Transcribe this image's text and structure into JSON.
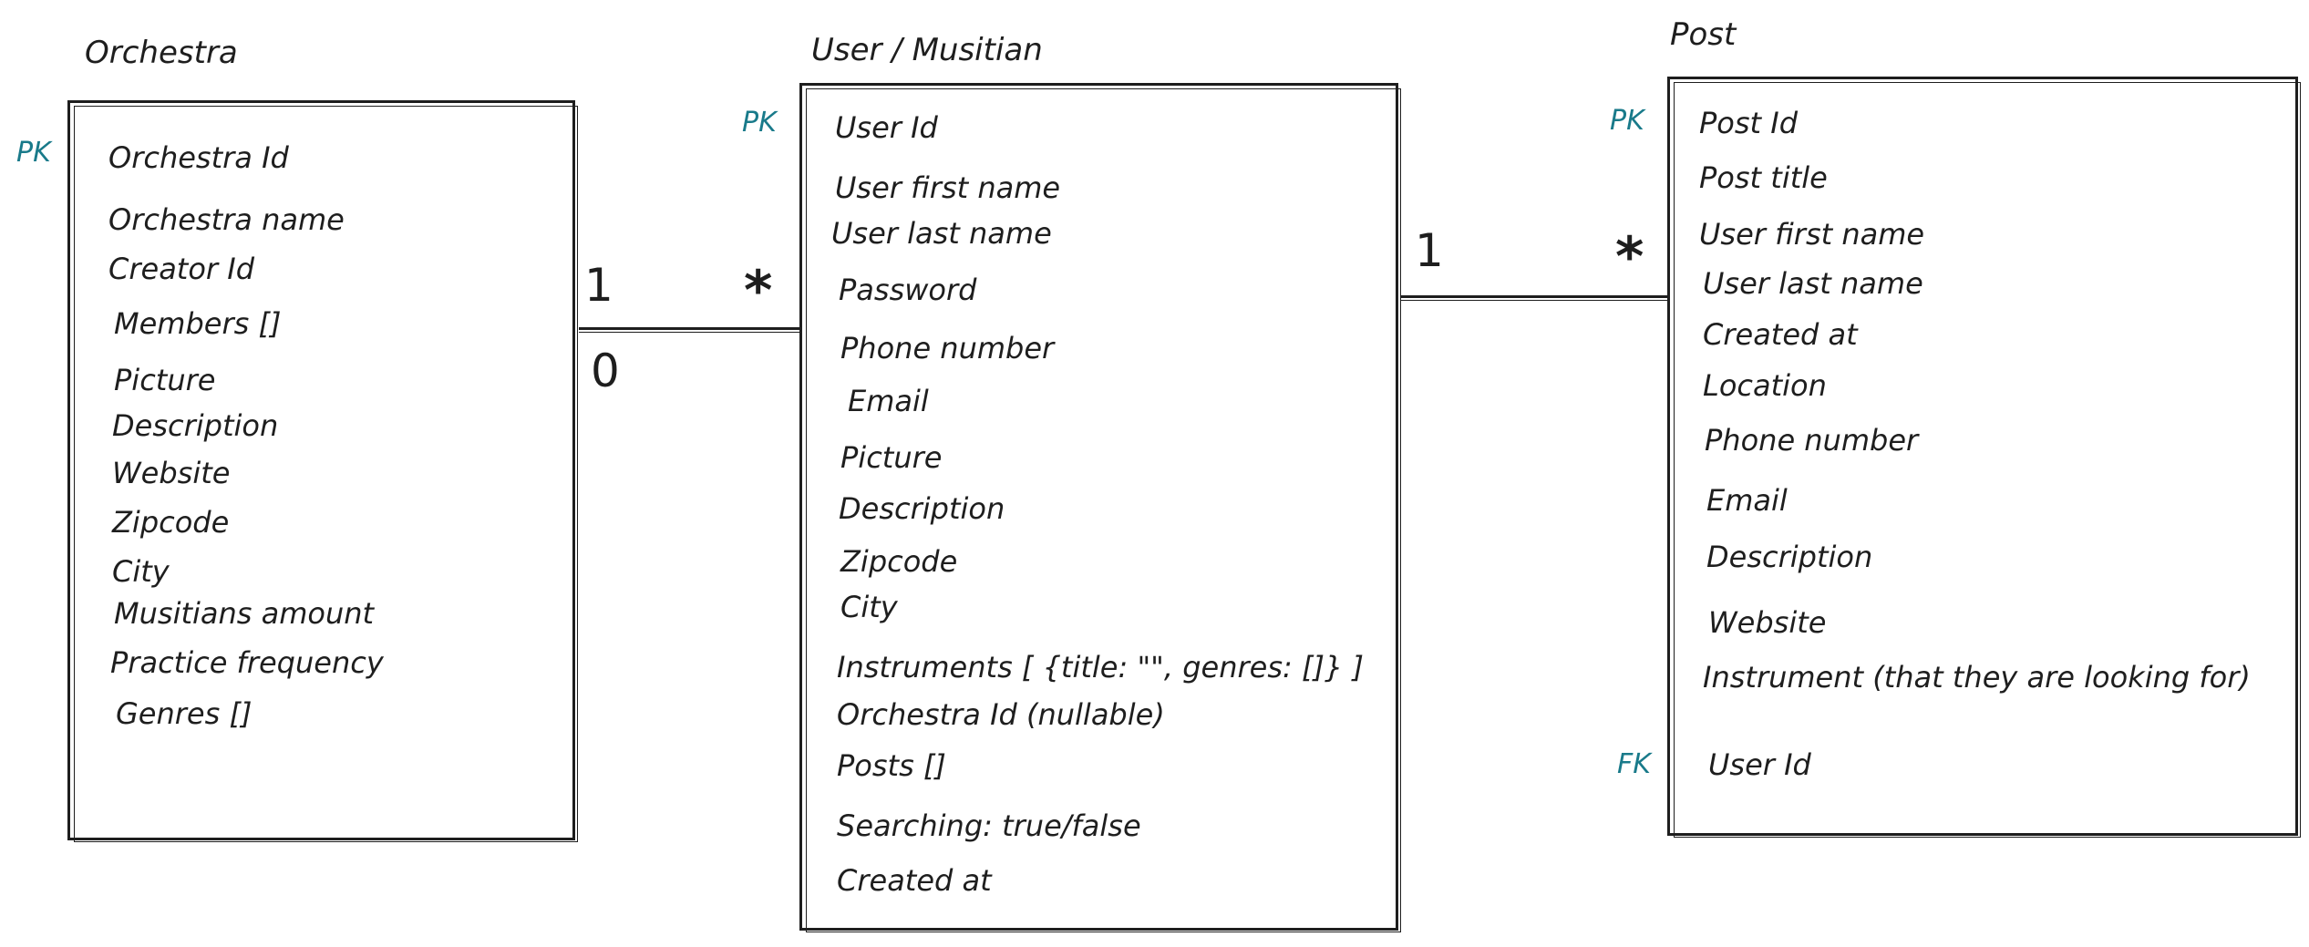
{
  "orchestra": {
    "title": "Orchestra",
    "pk_label": "PK",
    "fields": [
      "Orchestra Id",
      "Orchestra name",
      "Creator Id",
      "Members []",
      "Picture",
      "Description",
      "Website",
      "Zipcode",
      "City",
      "Musitians amount",
      "Practice frequency",
      "Genres []"
    ]
  },
  "user": {
    "title": "User / Musitian",
    "pk_label": "PK",
    "fields": [
      "User Id",
      "User first name",
      "User last name",
      "Password",
      "Phone number",
      "Email",
      "Picture",
      "Description",
      "Zipcode",
      "City",
      "Instruments [ {title: \"\", genres: []} ]",
      "Orchestra Id (nullable)",
      "Posts []",
      "Searching: true/false",
      "Created at"
    ]
  },
  "post": {
    "title": "Post",
    "pk_label": "PK",
    "fk_label": "FK",
    "fields": [
      "Post Id",
      "Post title",
      "User first name",
      "User last name",
      "Created at",
      "Location",
      "Phone number",
      "Email",
      "Description",
      "Website",
      "Instrument (that they are looking for)",
      "User Id"
    ]
  },
  "relations": {
    "orchestra_user": {
      "left_top": "1",
      "left_bottom": "0",
      "right": "*"
    },
    "user_post": {
      "left": "1",
      "right": "*"
    }
  }
}
